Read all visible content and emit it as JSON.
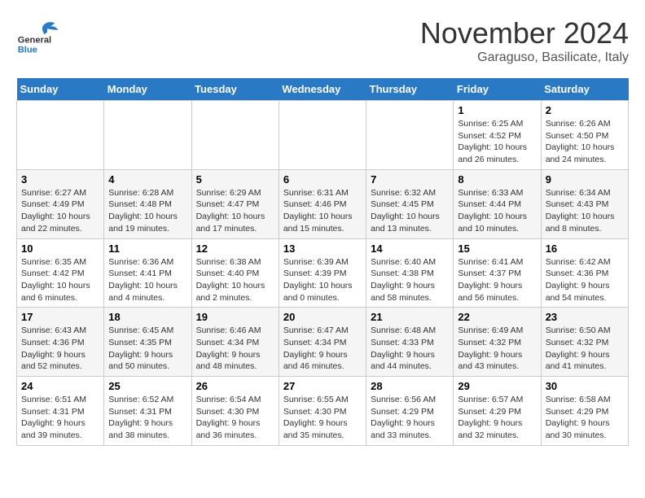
{
  "header": {
    "logo_line1": "General",
    "logo_line2": "Blue",
    "month": "November 2024",
    "location": "Garaguso, Basilicate, Italy"
  },
  "days_of_week": [
    "Sunday",
    "Monday",
    "Tuesday",
    "Wednesday",
    "Thursday",
    "Friday",
    "Saturday"
  ],
  "weeks": [
    [
      {
        "day": "",
        "info": ""
      },
      {
        "day": "",
        "info": ""
      },
      {
        "day": "",
        "info": ""
      },
      {
        "day": "",
        "info": ""
      },
      {
        "day": "",
        "info": ""
      },
      {
        "day": "1",
        "info": "Sunrise: 6:25 AM\nSunset: 4:52 PM\nDaylight: 10 hours\nand 26 minutes."
      },
      {
        "day": "2",
        "info": "Sunrise: 6:26 AM\nSunset: 4:50 PM\nDaylight: 10 hours\nand 24 minutes."
      }
    ],
    [
      {
        "day": "3",
        "info": "Sunrise: 6:27 AM\nSunset: 4:49 PM\nDaylight: 10 hours\nand 22 minutes."
      },
      {
        "day": "4",
        "info": "Sunrise: 6:28 AM\nSunset: 4:48 PM\nDaylight: 10 hours\nand 19 minutes."
      },
      {
        "day": "5",
        "info": "Sunrise: 6:29 AM\nSunset: 4:47 PM\nDaylight: 10 hours\nand 17 minutes."
      },
      {
        "day": "6",
        "info": "Sunrise: 6:31 AM\nSunset: 4:46 PM\nDaylight: 10 hours\nand 15 minutes."
      },
      {
        "day": "7",
        "info": "Sunrise: 6:32 AM\nSunset: 4:45 PM\nDaylight: 10 hours\nand 13 minutes."
      },
      {
        "day": "8",
        "info": "Sunrise: 6:33 AM\nSunset: 4:44 PM\nDaylight: 10 hours\nand 10 minutes."
      },
      {
        "day": "9",
        "info": "Sunrise: 6:34 AM\nSunset: 4:43 PM\nDaylight: 10 hours\nand 8 minutes."
      }
    ],
    [
      {
        "day": "10",
        "info": "Sunrise: 6:35 AM\nSunset: 4:42 PM\nDaylight: 10 hours\nand 6 minutes."
      },
      {
        "day": "11",
        "info": "Sunrise: 6:36 AM\nSunset: 4:41 PM\nDaylight: 10 hours\nand 4 minutes."
      },
      {
        "day": "12",
        "info": "Sunrise: 6:38 AM\nSunset: 4:40 PM\nDaylight: 10 hours\nand 2 minutes."
      },
      {
        "day": "13",
        "info": "Sunrise: 6:39 AM\nSunset: 4:39 PM\nDaylight: 10 hours\nand 0 minutes."
      },
      {
        "day": "14",
        "info": "Sunrise: 6:40 AM\nSunset: 4:38 PM\nDaylight: 9 hours\nand 58 minutes."
      },
      {
        "day": "15",
        "info": "Sunrise: 6:41 AM\nSunset: 4:37 PM\nDaylight: 9 hours\nand 56 minutes."
      },
      {
        "day": "16",
        "info": "Sunrise: 6:42 AM\nSunset: 4:36 PM\nDaylight: 9 hours\nand 54 minutes."
      }
    ],
    [
      {
        "day": "17",
        "info": "Sunrise: 6:43 AM\nSunset: 4:36 PM\nDaylight: 9 hours\nand 52 minutes."
      },
      {
        "day": "18",
        "info": "Sunrise: 6:45 AM\nSunset: 4:35 PM\nDaylight: 9 hours\nand 50 minutes."
      },
      {
        "day": "19",
        "info": "Sunrise: 6:46 AM\nSunset: 4:34 PM\nDaylight: 9 hours\nand 48 minutes."
      },
      {
        "day": "20",
        "info": "Sunrise: 6:47 AM\nSunset: 4:34 PM\nDaylight: 9 hours\nand 46 minutes."
      },
      {
        "day": "21",
        "info": "Sunrise: 6:48 AM\nSunset: 4:33 PM\nDaylight: 9 hours\nand 44 minutes."
      },
      {
        "day": "22",
        "info": "Sunrise: 6:49 AM\nSunset: 4:32 PM\nDaylight: 9 hours\nand 43 minutes."
      },
      {
        "day": "23",
        "info": "Sunrise: 6:50 AM\nSunset: 4:32 PM\nDaylight: 9 hours\nand 41 minutes."
      }
    ],
    [
      {
        "day": "24",
        "info": "Sunrise: 6:51 AM\nSunset: 4:31 PM\nDaylight: 9 hours\nand 39 minutes."
      },
      {
        "day": "25",
        "info": "Sunrise: 6:52 AM\nSunset: 4:31 PM\nDaylight: 9 hours\nand 38 minutes."
      },
      {
        "day": "26",
        "info": "Sunrise: 6:54 AM\nSunset: 4:30 PM\nDaylight: 9 hours\nand 36 minutes."
      },
      {
        "day": "27",
        "info": "Sunrise: 6:55 AM\nSunset: 4:30 PM\nDaylight: 9 hours\nand 35 minutes."
      },
      {
        "day": "28",
        "info": "Sunrise: 6:56 AM\nSunset: 4:29 PM\nDaylight: 9 hours\nand 33 minutes."
      },
      {
        "day": "29",
        "info": "Sunrise: 6:57 AM\nSunset: 4:29 PM\nDaylight: 9 hours\nand 32 minutes."
      },
      {
        "day": "30",
        "info": "Sunrise: 6:58 AM\nSunset: 4:29 PM\nDaylight: 9 hours\nand 30 minutes."
      }
    ]
  ]
}
